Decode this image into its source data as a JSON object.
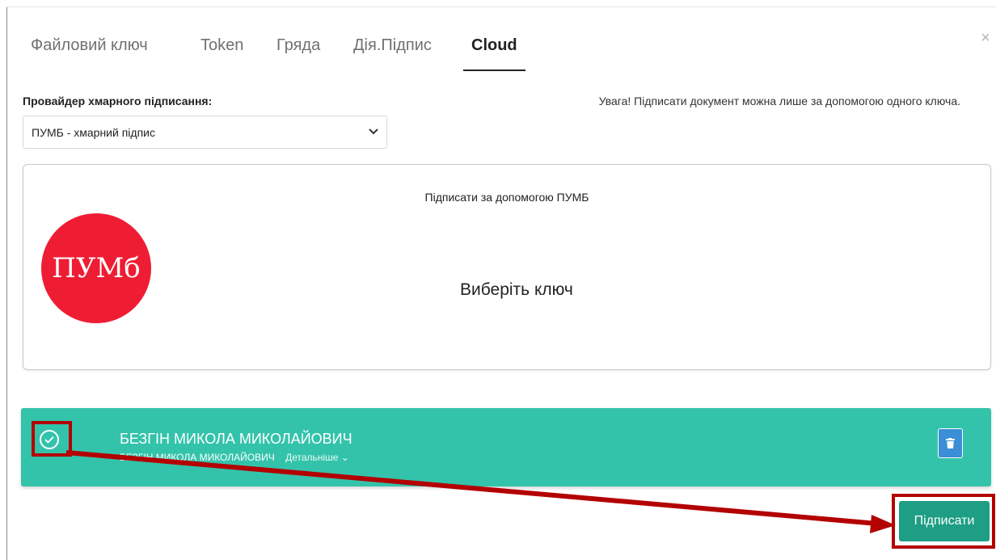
{
  "tabs": [
    {
      "label": "Файловий ключ",
      "active": false
    },
    {
      "label": "Token",
      "active": false
    },
    {
      "label": "Гряда",
      "active": false
    },
    {
      "label": "Дія.Підпис",
      "active": false
    },
    {
      "label": "Cloud",
      "active": true
    }
  ],
  "close_icon": "close-icon",
  "provider": {
    "label": "Провайдер хмарного підписання:",
    "selected": "ПУМБ - хмарний підпис"
  },
  "notice": "Увага! Підписати документ можна лише за допомогою одного ключа.",
  "card": {
    "title": "Підписати за допомогою  ПУМБ",
    "logo_text": "ПУМб",
    "logo_color": "#ee1d33",
    "prompt": "Виберіть ключ"
  },
  "key": {
    "name": "БЕЗГІН МИКОЛА МИКОЛАЙОВИЧ",
    "owner": "БЕЗГІН МИКОЛА МИКОЛАЙОВИЧ",
    "details_label": "Детальніше ⌄",
    "selected": true,
    "row_color": "#33c3ab"
  },
  "sign_button": {
    "label": "Підписати",
    "color": "#1e9e84"
  },
  "annotation_color": "#b30000"
}
